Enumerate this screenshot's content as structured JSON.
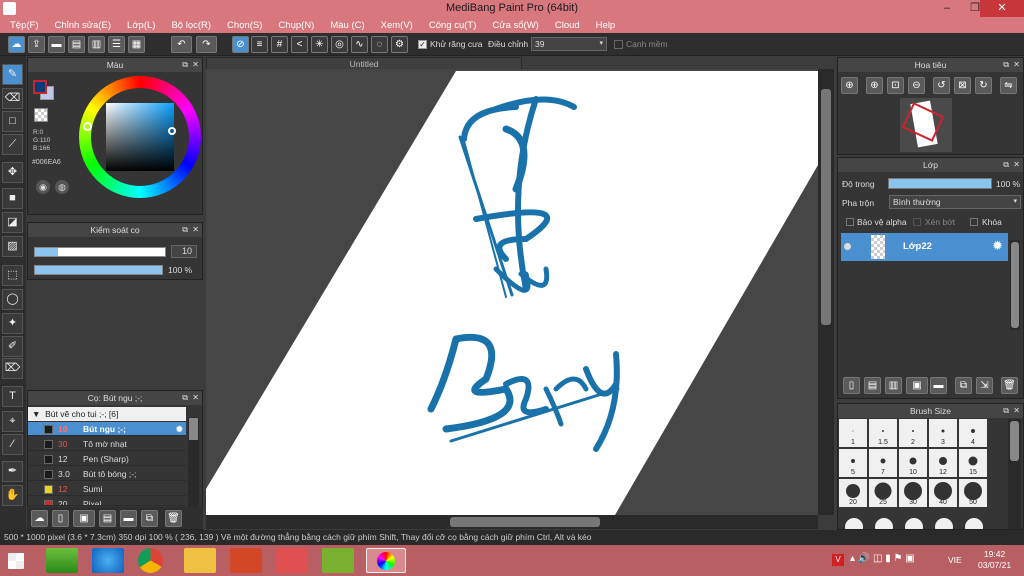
{
  "window": {
    "title": "MediBang Paint Pro (64bit)"
  },
  "menu": [
    "Tệp(F)",
    "Chỉnh sửa(E)",
    "Lớp(L)",
    "Bộ lọc(R)",
    "Chọn(S)",
    "Chụp(N)",
    "Màu (C)",
    "Xem(V)",
    "Công cụ(T)",
    "Cửa sổ(W)",
    "Cloud",
    "Help"
  ],
  "toolbar": {
    "antialias_label": "Khử răng cưa",
    "adjust_label": "Điều chỉnh",
    "adjust_value": "39",
    "smooth_label": "Cạnh mềm"
  },
  "color_panel": {
    "title": "Màu",
    "r": "R:0",
    "g": "G:110",
    "b": "B:166",
    "hex": "#006EA6",
    "current_color": "#006ea6"
  },
  "brush_control": {
    "title": "Kiểm soát cọ",
    "size": "10",
    "opacity": "100 %"
  },
  "document": {
    "tab": "Untitled",
    "text_top": "Blue",
    "text_bottom": "Bery",
    "ink_color": "#1a72ab"
  },
  "navigator": {
    "title": "Hoa tiêu"
  },
  "layer_panel": {
    "title": "Lớp",
    "opacity_label": "Độ trong",
    "opacity_value": "100 %",
    "blend_label": "Pha trộn",
    "blend_value": "Bình thường",
    "protect_alpha": "Bảo vệ alpha",
    "clipping": "Xén bớt",
    "lock": "Khóa",
    "layer_name": "Lớp22"
  },
  "brush_list": {
    "title": "Cọ: Bút ngu ;-;",
    "group": "Bút vẽ cho tui ;-; [6]",
    "items": [
      {
        "size": "10",
        "name": "Bút ngu ;-;",
        "color": "#1a1a1a",
        "sizecolor": "#e05a5a",
        "selected": true
      },
      {
        "size": "30",
        "name": "Tô mờ nhạt",
        "color": "#1a1a1a",
        "sizecolor": "#e05a5a"
      },
      {
        "size": "12",
        "name": "Pen (Sharp)",
        "color": "#1a1a1a",
        "sizecolor": "#ddd"
      },
      {
        "size": "3.0",
        "name": "Bút tô bóng ;-;",
        "color": "#1a1a1a",
        "sizecolor": "#ddd"
      },
      {
        "size": "12",
        "name": "Sumi",
        "color": "#e8d21e",
        "sizecolor": "#e05a5a"
      },
      {
        "size": "20",
        "name": "Pixel",
        "color": "#d12a2a",
        "sizecolor": "#ddd"
      }
    ]
  },
  "brush_size": {
    "title": "Brush Size",
    "sizes": [
      "1",
      "1.5",
      "2",
      "3",
      "4",
      "5",
      "7",
      "10",
      "12",
      "15",
      "20",
      "25",
      "30",
      "40",
      "50"
    ]
  },
  "status": {
    "text": "500 * 1000 pixel   (3.6 * 7.3cm)   350 dpi   100 %   ( 236, 139 )   Vẽ một đường thẳng bằng cách giữ phím Shift, Thay đổi cỡ cọ bằng cách giữ phím Ctrl, Alt và kéo"
  },
  "taskbar": {
    "lang": "VIE",
    "time": "19:42",
    "date": "03/07/21"
  }
}
